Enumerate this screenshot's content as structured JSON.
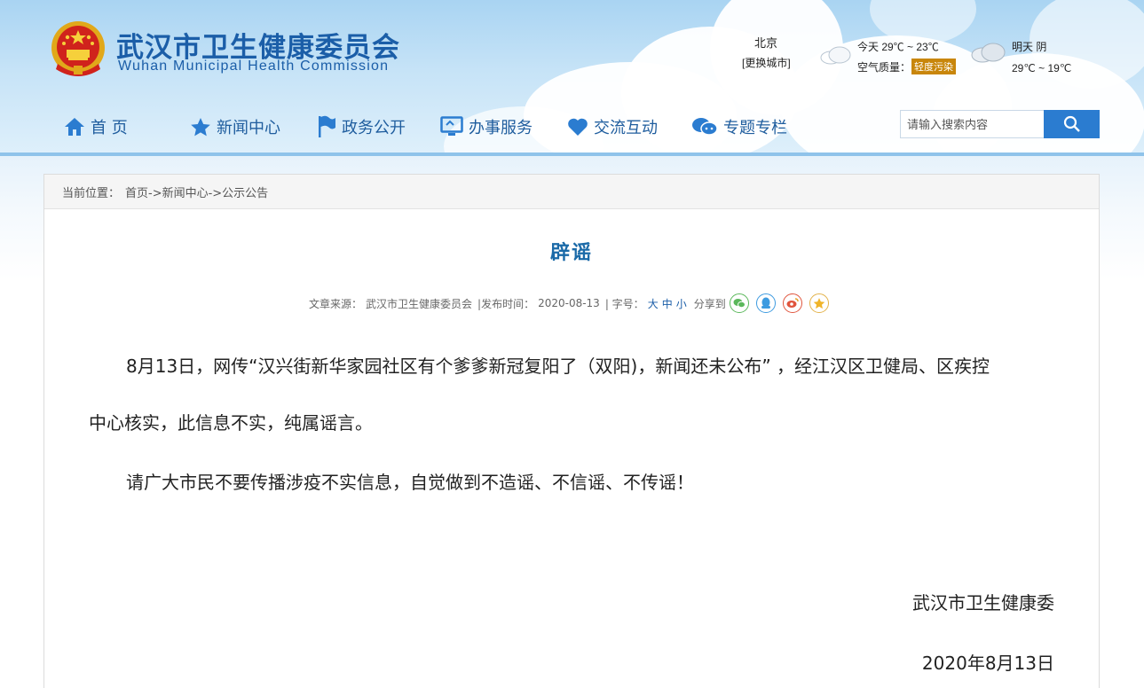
{
  "site": {
    "title_cn": "武汉市卫生健康委员会",
    "title_en": "Wuhan Municipal Health Commission"
  },
  "weather": {
    "city": "北京",
    "change_city": "[更换城市]",
    "today": "今天  29℃ ~ 23℃",
    "aqi_label": "空气质量：",
    "aqi_value": "轻度污染",
    "tomorrow": "明天  阴",
    "tomorrow_temp": "29℃ ~ 19℃",
    "aqi_color": "#c8860b"
  },
  "nav": {
    "items": [
      {
        "label": "首  页",
        "icon": "home-icon"
      },
      {
        "label": "新闻中心",
        "icon": "star-icon"
      },
      {
        "label": "政务公开",
        "icon": "flag-icon"
      },
      {
        "label": "办事服务",
        "icon": "monitor-icon"
      },
      {
        "label": "交流互动",
        "icon": "heart-icon"
      },
      {
        "label": "专题专栏",
        "icon": "chat-icon"
      }
    ],
    "search_placeholder": "请输入搜索内容"
  },
  "breadcrumb": {
    "prefix": "当前位置：",
    "path": "首页->新闻中心->公示公告"
  },
  "article": {
    "title": "辟谣",
    "meta": {
      "source_label": "文章来源：",
      "source": "武汉市卫生健康委员会",
      "published_label": "|发布时间：",
      "published": "2020-08-13",
      "fontsize_label": "|  字号：",
      "size_large": "大",
      "size_medium": "中",
      "size_small": "小",
      "share_label": "分享到"
    },
    "para1_line1": "8月13日，网传“汉兴街新华家园社区有个爹爹新冠复阳了（双阳)，新闻还未公布”  ，经江汉区卫健局、区疾控",
    "para1_line2": "中心核实，此信息不实，纯属谣言。",
    "para2": "请广大市民不要传播涉疫不实信息，自觉做到不造谣、不信谣、不传谣！",
    "signature": "武汉市卫生健康委",
    "date": "2020年8月13日"
  },
  "colors": {
    "brand_blue": "#1b5ea8",
    "title_blue": "#1b6aa8",
    "search_button": "#2b7cd0"
  }
}
